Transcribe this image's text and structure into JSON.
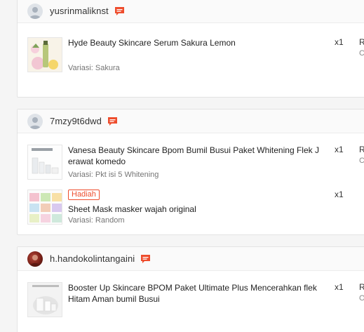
{
  "orders": [
    {
      "username": "yusrinmaliknst",
      "items": [
        {
          "name": "Hyde Beauty Skincare Serum Sakura Lemon",
          "variation": "Variasi: Sakura",
          "qty": "x1",
          "cut_top": "R",
          "cut_bottom": "C"
        }
      ]
    },
    {
      "username": "7mzy9t6dwd",
      "items": [
        {
          "name": "Vanesa Beauty Skincare Bpom Bumil Busui Paket Whitening Flek J erawat komedo",
          "variation": "Variasi: Pkt isi 5 Whitening",
          "qty": "x1",
          "cut_top": "R",
          "cut_bottom": "C"
        },
        {
          "badge": "Hadiah",
          "name": "Sheet Mask masker wajah original",
          "variation": "Variasi: Random",
          "qty": "x1"
        }
      ]
    },
    {
      "username": "h.handokolintangaini",
      "items": [
        {
          "name": "Booster Up Skincare BPOM Paket Ultimate Plus Mencerahkan flek Hitam Aman bumil Busui",
          "variation": "",
          "qty": "x1",
          "cut_top": "R",
          "cut_bottom": "O"
        }
      ]
    }
  ],
  "colors": {
    "accent": "#ee4d2d",
    "chat_icon": "#ee4d2d"
  },
  "icons": {
    "avatar": "user-avatar-icon",
    "chat": "chat-icon"
  }
}
